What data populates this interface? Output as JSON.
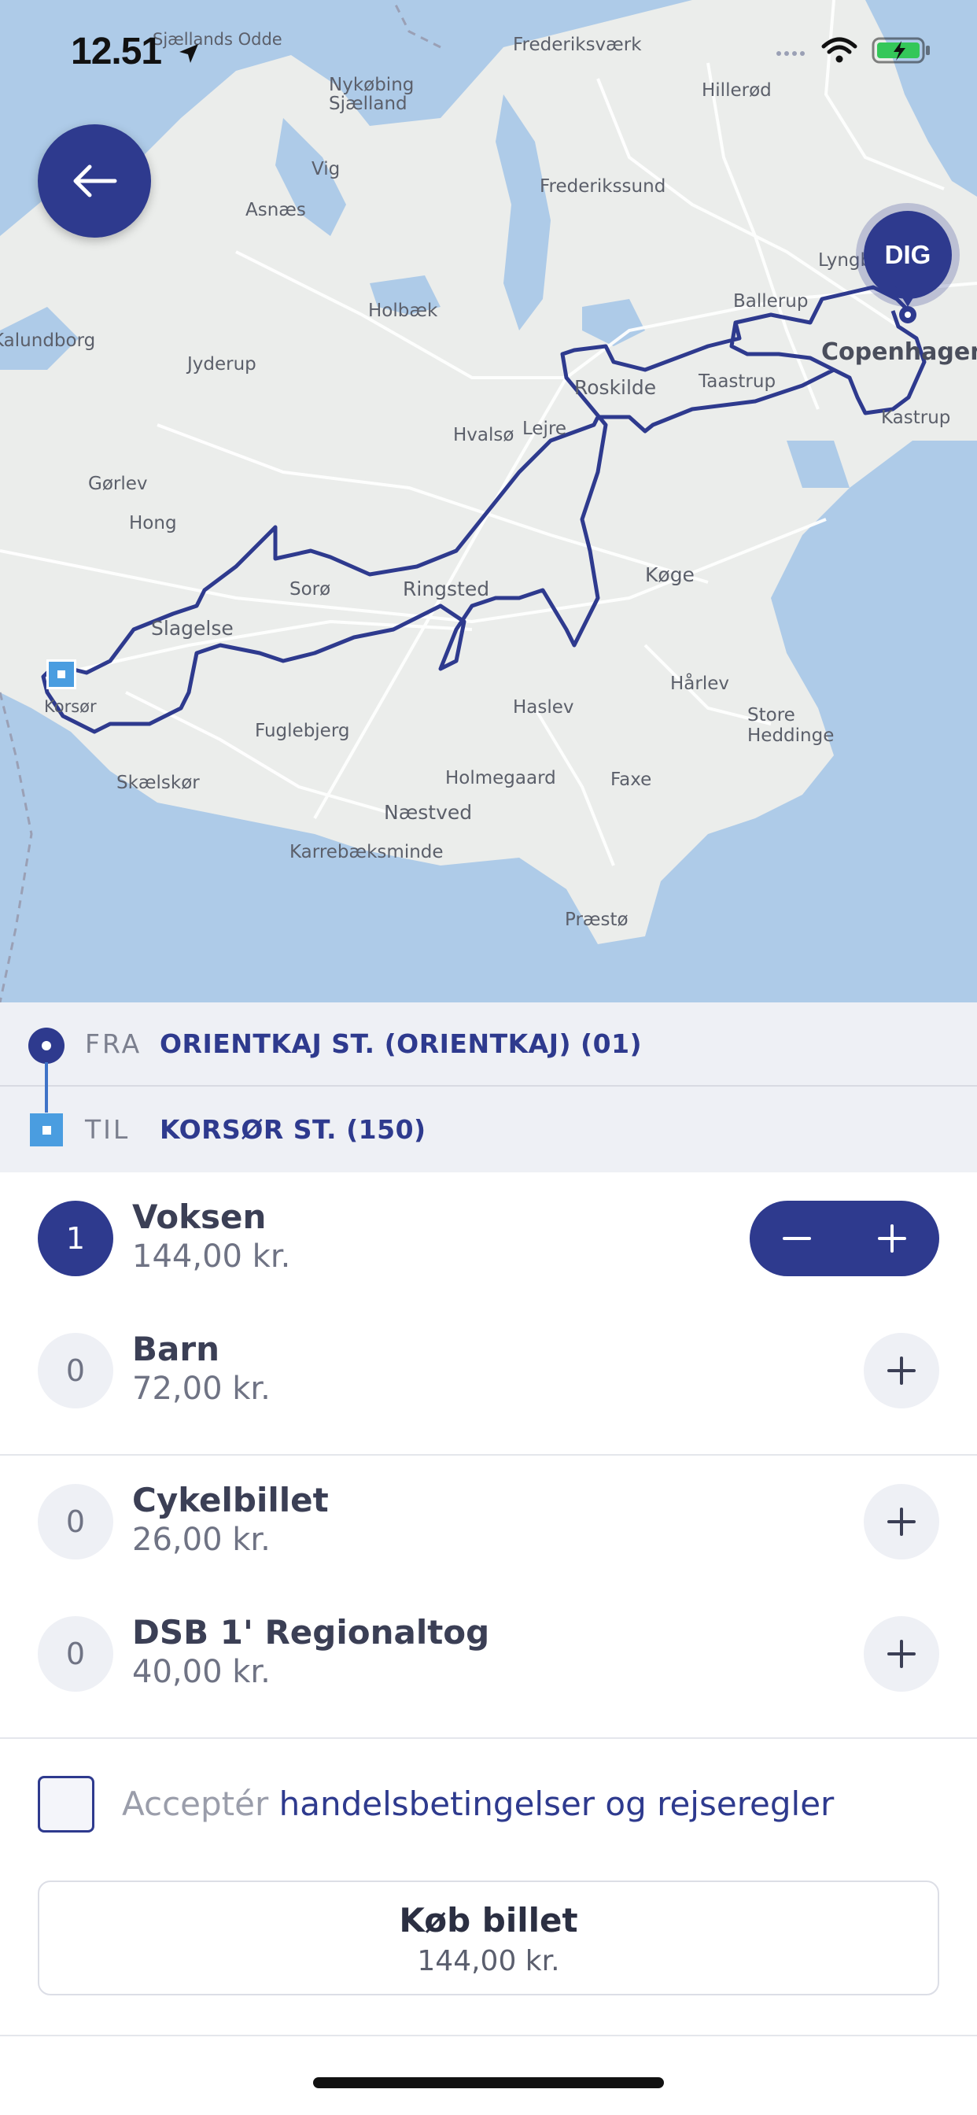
{
  "status_bar": {
    "time": "12.51"
  },
  "map": {
    "places": [
      {
        "name": "Sjællands Odde",
        "cls": ""
      },
      {
        "name": "Frederiksværk",
        "cls": ""
      },
      {
        "name": "Hillerød",
        "cls": ""
      },
      {
        "name": "Nykøbing Sjælland",
        "cls": ""
      },
      {
        "name": "Vig",
        "cls": ""
      },
      {
        "name": "Frederikssund",
        "cls": ""
      },
      {
        "name": "Asnæs",
        "cls": ""
      },
      {
        "name": "Lyngby",
        "cls": ""
      },
      {
        "name": "Ballerup",
        "cls": ""
      },
      {
        "name": "Holbæk",
        "cls": ""
      },
      {
        "name": "Copenhagen",
        "cls": "city"
      },
      {
        "name": "Kalundborg",
        "cls": ""
      },
      {
        "name": "Jyderup",
        "cls": ""
      },
      {
        "name": "Roskilde",
        "cls": ""
      },
      {
        "name": "Taastrup",
        "cls": ""
      },
      {
        "name": "Kastrup",
        "cls": ""
      },
      {
        "name": "Hvalsø",
        "cls": ""
      },
      {
        "name": "Lejre",
        "cls": ""
      },
      {
        "name": "Gørlev",
        "cls": ""
      },
      {
        "name": "Hong",
        "cls": ""
      },
      {
        "name": "Sorø",
        "cls": ""
      },
      {
        "name": "Ringsted",
        "cls": ""
      },
      {
        "name": "Køge",
        "cls": ""
      },
      {
        "name": "Slagelse",
        "cls": ""
      },
      {
        "name": "Korsør",
        "cls": ""
      },
      {
        "name": "Haslev",
        "cls": ""
      },
      {
        "name": "Hårlev",
        "cls": ""
      },
      {
        "name": "Store Heddinge",
        "cls": ""
      },
      {
        "name": "Fuglebjerg",
        "cls": ""
      },
      {
        "name": "Skælskør",
        "cls": ""
      },
      {
        "name": "Holmegaard",
        "cls": ""
      },
      {
        "name": "Faxe",
        "cls": ""
      },
      {
        "name": "Næstved",
        "cls": ""
      },
      {
        "name": "Karrebæksminde",
        "cls": ""
      },
      {
        "name": "Præstø",
        "cls": ""
      }
    ],
    "user_pin_label": "DIG"
  },
  "route": {
    "from_label": "FRA",
    "from_value": "ORIENTKAJ ST. (ORIENTKAJ) (01)",
    "to_label": "TIL",
    "to_value": "KORSØR ST. (150)"
  },
  "tickets": [
    {
      "qty": "1",
      "name": "Voksen",
      "price": "144,00 kr."
    },
    {
      "qty": "0",
      "name": "Barn",
      "price": "72,00 kr."
    },
    {
      "qty": "0",
      "name": "Cykelbillet",
      "price": "26,00 kr."
    },
    {
      "qty": "0",
      "name": "DSB 1' Regionaltog",
      "price": "40,00 kr."
    }
  ],
  "accept": {
    "prefix": "Acceptér",
    "link": "handelsbetingelser og rejseregler"
  },
  "buy": {
    "label": "Køb billet",
    "price": "144,00 kr."
  },
  "colors": {
    "accent": "#2e3a8e",
    "secondary": "#4a9de0",
    "water": "#aecbe8",
    "land": "#ebedeb"
  }
}
